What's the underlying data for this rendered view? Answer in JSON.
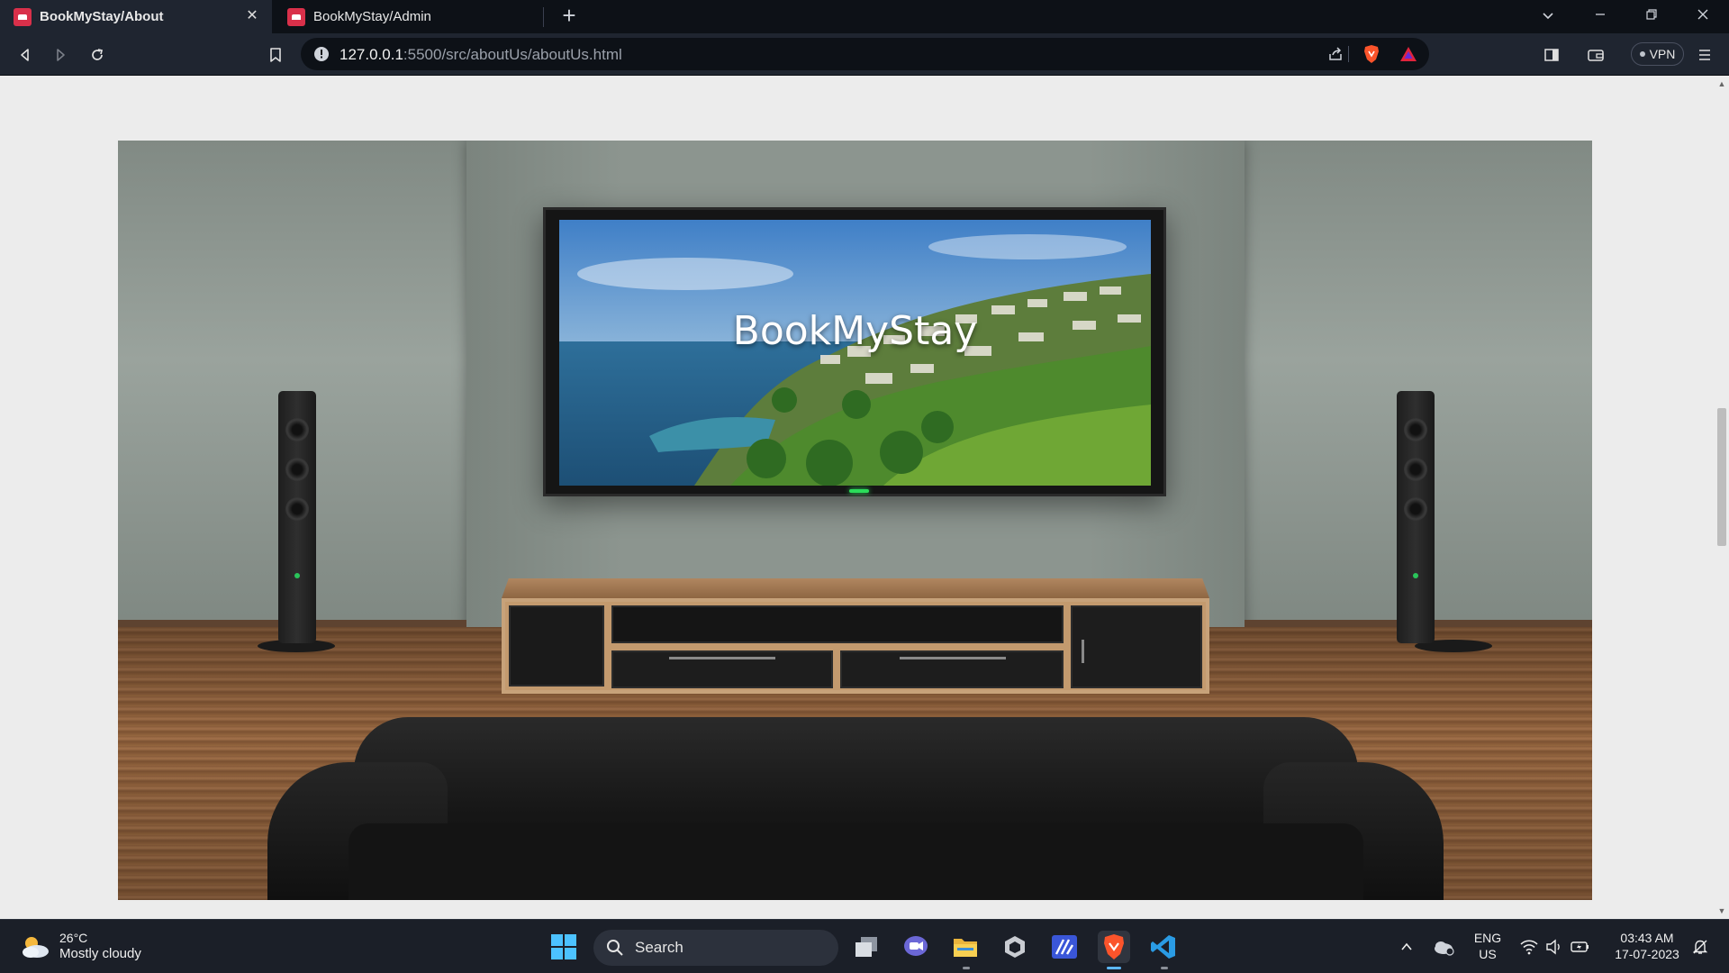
{
  "browser": {
    "tabs": [
      {
        "title": "BookMyStay/About",
        "active": true
      },
      {
        "title": "BookMyStay/Admin",
        "active": false
      }
    ],
    "new_tab_symbol": "+",
    "close_symbol": "✕",
    "url_host": "127.0.0.1",
    "url_rest": ":5500/src/aboutUs/aboutUs.html",
    "vpn_label": "VPN",
    "colors": {
      "brand_red": "#d9304a",
      "brave_orange": "#fb542b"
    }
  },
  "page": {
    "hero_title": "BookMyStay"
  },
  "taskbar": {
    "weather_temp": "26°C",
    "weather_condition": "Mostly cloudy",
    "search_label": "Search",
    "language_line1": "ENG",
    "language_line2": "US",
    "time": "03:43 AM",
    "date": "17-07-2023",
    "apps": [
      "start-icon",
      "task-view-icon",
      "teams-chat-icon",
      "file-explorer-icon",
      "unity-icon",
      "visual-studio-icon",
      "brave-browser-icon",
      "vscode-icon"
    ]
  }
}
